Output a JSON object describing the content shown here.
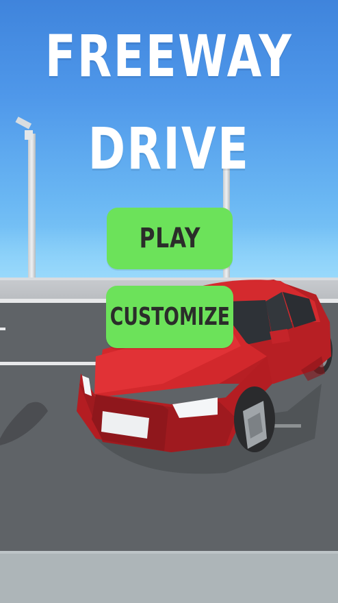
{
  "title": {
    "line1": "FREEWAY",
    "line2": "DRIVE"
  },
  "buttons": {
    "play_label": "PLAY",
    "customize_label": "CUSTOMIZE"
  },
  "colors": {
    "button_green": "#6ce25a",
    "car_red": "#d8262a",
    "sky_blue": "#4f98ea"
  }
}
